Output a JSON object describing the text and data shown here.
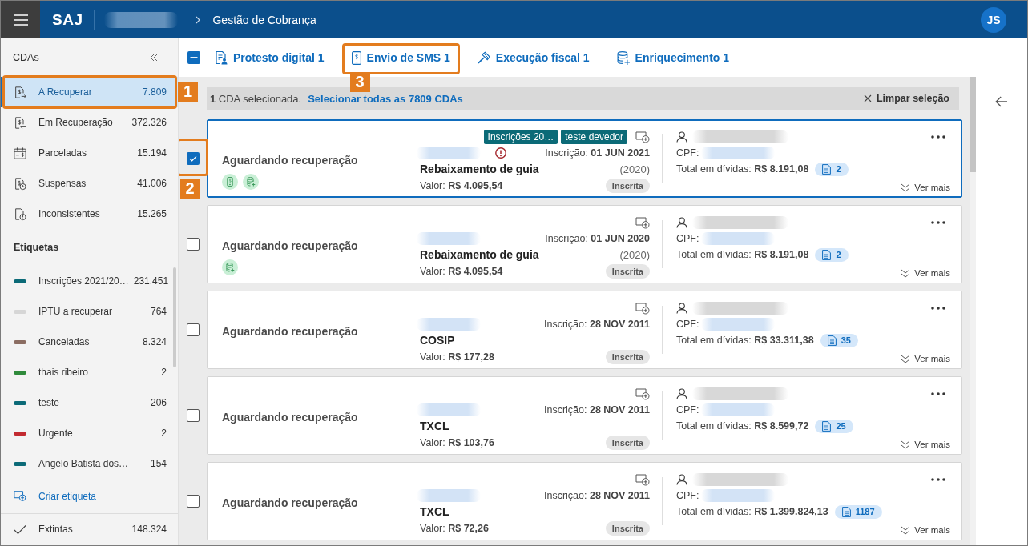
{
  "header": {
    "logo": "SAJ",
    "title": "Gestão de Cobrança",
    "avatar": "JS"
  },
  "sidebar": {
    "title": "CDAs",
    "items": [
      {
        "kind": "recover",
        "label": "A Recuperar",
        "count": "7.809",
        "selected": true,
        "callout": "1"
      },
      {
        "kind": "in_recovery",
        "label": "Em Recuperação",
        "count": "372.326",
        "selected": false
      },
      {
        "kind": "installments",
        "label": "Parceladas",
        "count": "15.194",
        "selected": false
      },
      {
        "kind": "suspended",
        "label": "Suspensas",
        "count": "41.006",
        "selected": false
      },
      {
        "kind": "inconsistent",
        "label": "Inconsistentes",
        "count": "15.265",
        "selected": false
      }
    ],
    "tags_title": "Etiquetas",
    "tags": [
      {
        "label": "Inscrições 2021/20…",
        "count": "231.451",
        "color": "#0b6a77",
        "selected": false
      },
      {
        "label": "IPTU a recuperar",
        "count": "764",
        "color": "#d6d6d6",
        "selected": false
      },
      {
        "label": "Canceladas",
        "count": "8.324",
        "color": "#8b6d62",
        "selected": false
      },
      {
        "label": "thais ribeiro",
        "count": "2",
        "color": "#2f8a3b",
        "selected": false
      },
      {
        "label": "teste",
        "count": "206",
        "color": "#0b6a77",
        "selected": false
      },
      {
        "label": "Urgente",
        "count": "2",
        "color": "#c22a30",
        "selected": false
      },
      {
        "label": "Angelo Batista dos…",
        "count": "154",
        "color": "#0b6a77",
        "selected": false
      }
    ],
    "create_tag": "Criar etiqueta",
    "footer_item": {
      "label": "Extintas",
      "count": "148.324",
      "selected": false
    }
  },
  "toolbar": {
    "select_all": {
      "partial": true
    },
    "actions": [
      {
        "kind": "protest",
        "label": "Protesto digital 1"
      },
      {
        "kind": "sms",
        "label": "Envio de SMS 1",
        "callout": "3"
      },
      {
        "kind": "fiscal",
        "label": "Execução fiscal 1"
      },
      {
        "kind": "enrich",
        "label": "Enriquecimento 1"
      }
    ]
  },
  "selection_bar": {
    "text": "**1** CDA selecionada.",
    "link": "Selecionar todas as 7809 CDAs",
    "clear": "Limpar seleção"
  },
  "cards": [
    {
      "selected": true,
      "callout": "2",
      "status": "Aguardando recuperação",
      "sent": [
        {
          "kind": "sms"
        },
        {
          "kind": "enrich"
        }
      ],
      "warning": true,
      "tags": [
        {
          "label": "Inscrições 20…",
          "color": "#0b6a77"
        },
        {
          "label": "teste devedor",
          "color": "#0b6a77"
        }
      ],
      "date": "Inscrição: **01 JUN 2021**",
      "title": "Rebaixamento de guia",
      "year": "(2020)",
      "value": "Valor: **R$ 4.095,54**",
      "situation": "Inscrita",
      "cpf_label": "CPF:",
      "total": "Total em dívidas: **R$ 8.191,08**",
      "docs": "2",
      "more": "Ver mais"
    },
    {
      "selected": false,
      "status": "Aguardando recuperação",
      "sent": [
        {
          "kind": "enrich"
        }
      ],
      "warning": false,
      "date": "Inscrição: **01 JUN 2020**",
      "title": "Rebaixamento de guia",
      "year": "(2020)",
      "value": "Valor: **R$ 4.095,54**",
      "situation": "Inscrita",
      "cpf_label": "CPF:",
      "total": "Total em dívidas: **R$ 8.191,08**",
      "docs": "2",
      "more": "Ver mais"
    },
    {
      "selected": false,
      "status": "Aguardando recuperação",
      "warning": false,
      "date": "Inscrição: **28 NOV 2011**",
      "title": "COSIP",
      "value": "Valor: **R$ 177,28**",
      "situation": "Inscrita",
      "cpf_label": "CPF:",
      "total": "Total em dívidas: **R$ 33.311,38**",
      "docs": "35",
      "more": "Ver mais"
    },
    {
      "selected": false,
      "status": "Aguardando recuperação",
      "warning": false,
      "date": "Inscrição: **28 NOV 2011**",
      "title": "TXCL",
      "value": "Valor: **R$ 103,76**",
      "situation": "Inscrita",
      "cpf_label": "CPF:",
      "total": "Total em dívidas: **R$ 8.599,72**",
      "docs": "25",
      "more": "Ver mais"
    },
    {
      "selected": false,
      "status": "Aguardando recuperação",
      "warning": false,
      "date": "Inscrição: **28 NOV 2011**",
      "title": "TXCL",
      "value": "Valor: **R$ 72,26**",
      "situation": "Inscrita",
      "cpf_label": "CPF:",
      "total": "Total em dívidas: **R$ 1.399.824,13**",
      "docs": "1187",
      "more": "Ver mais"
    }
  ]
}
